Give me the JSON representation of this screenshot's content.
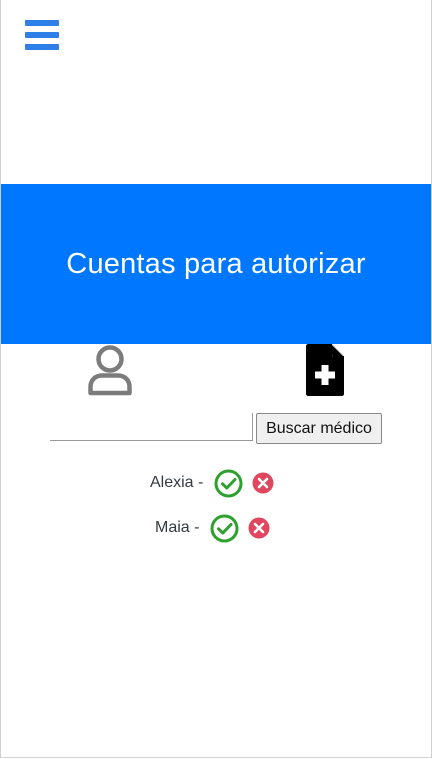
{
  "nav": {
    "menu_icon": "hamburger-icon",
    "menu_color": "#2f7fe8"
  },
  "header": {
    "title": "Cuentas para autorizar",
    "background": "#0077ff"
  },
  "tabs": {
    "users_icon": "user-icon",
    "doctors_icon": "file-plus-icon"
  },
  "search": {
    "value": "",
    "placeholder": "",
    "button_label": "Buscar médico"
  },
  "accounts": [
    {
      "name": "Alexia -",
      "approve_icon": "check-circle-icon",
      "reject_icon": "x-circle-icon"
    },
    {
      "name": "Maia -",
      "approve_icon": "check-circle-icon",
      "reject_icon": "x-circle-icon"
    }
  ],
  "colors": {
    "approve": "#2ea02e",
    "reject": "#e0475e"
  }
}
